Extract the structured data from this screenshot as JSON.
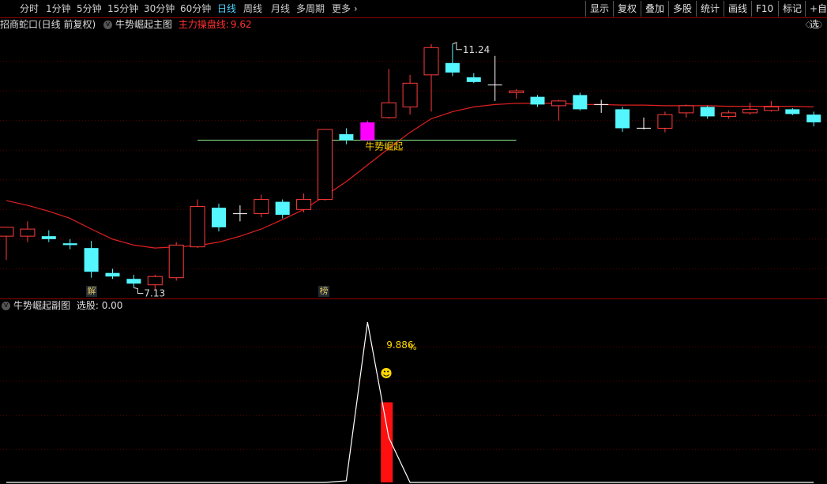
{
  "toolbar": {
    "periods": [
      "分时",
      "1分钟",
      "5分钟",
      "15分钟",
      "30分钟",
      "60分钟",
      "日线",
      "周线",
      "月线",
      "多周期",
      "更多"
    ],
    "active_period": "日线",
    "right_buttons": [
      "显示",
      "复权",
      "叠加",
      "多股",
      "统计",
      "画线",
      "F10",
      "标记",
      "+自选"
    ]
  },
  "main_panel": {
    "stock_title": "招商蛇口(日线 前复权)",
    "indicator_name": "牛势崛起主图",
    "line_label": "主力操盘线:",
    "line_value": "9.62",
    "high_label": "11.24",
    "low_label": "7.13",
    "signal_text": "牛势崛起",
    "marker_left": "解",
    "marker_right": "榜"
  },
  "sub_panel": {
    "indicator_name": "牛势崛起副图",
    "select_label": "选股: 0.00",
    "pct_text": "9.886",
    "pct_suffix": "%",
    "smiley": "☻"
  },
  "colors": {
    "up": "#ff3b3b",
    "down": "#54f6ff",
    "highlight": "#ff00ff",
    "ma_line": "#e02020",
    "signal_line": "#90ee90",
    "grid": "#5a0000"
  },
  "chart_data": {
    "type": "candlestick",
    "candles": [
      {
        "o": 8.0,
        "h": 8.15,
        "l": 7.6,
        "c": 8.15,
        "dir": "up"
      },
      {
        "o": 8.0,
        "h": 8.25,
        "l": 7.9,
        "c": 8.12,
        "dir": "up"
      },
      {
        "o": 8.0,
        "h": 8.1,
        "l": 7.9,
        "c": 7.95,
        "dir": "down"
      },
      {
        "o": 7.88,
        "h": 7.95,
        "l": 7.78,
        "c": 7.85,
        "dir": "down"
      },
      {
        "o": 7.8,
        "h": 7.92,
        "l": 7.3,
        "c": 7.4,
        "dir": "down"
      },
      {
        "o": 7.38,
        "h": 7.45,
        "l": 7.28,
        "c": 7.32,
        "dir": "down"
      },
      {
        "o": 7.28,
        "h": 7.35,
        "l": 7.13,
        "c": 7.2,
        "dir": "down"
      },
      {
        "o": 7.18,
        "h": 7.35,
        "l": 7.1,
        "c": 7.32,
        "dir": "up"
      },
      {
        "o": 7.3,
        "h": 7.9,
        "l": 7.25,
        "c": 7.85,
        "dir": "up"
      },
      {
        "o": 7.82,
        "h": 8.62,
        "l": 7.8,
        "c": 8.5,
        "dir": "up"
      },
      {
        "o": 8.48,
        "h": 8.55,
        "l": 8.08,
        "c": 8.15,
        "dir": "down"
      },
      {
        "o": 8.38,
        "h": 8.52,
        "l": 8.25,
        "c": 8.38,
        "dir": "flat"
      },
      {
        "o": 8.38,
        "h": 8.7,
        "l": 8.32,
        "c": 8.62,
        "dir": "up"
      },
      {
        "o": 8.58,
        "h": 8.62,
        "l": 8.3,
        "c": 8.36,
        "dir": "down"
      },
      {
        "o": 8.45,
        "h": 8.72,
        "l": 8.4,
        "c": 8.62,
        "dir": "up"
      },
      {
        "o": 8.62,
        "h": 9.8,
        "l": 8.6,
        "c": 9.8,
        "dir": "up"
      },
      {
        "o": 9.72,
        "h": 9.82,
        "l": 9.55,
        "c": 9.62,
        "dir": "down"
      },
      {
        "o": 9.62,
        "h": 9.95,
        "l": 9.6,
        "c": 9.92,
        "dir": "highlight"
      },
      {
        "o": 10.0,
        "h": 10.82,
        "l": 9.98,
        "c": 10.25,
        "dir": "up"
      },
      {
        "o": 10.18,
        "h": 10.72,
        "l": 10.05,
        "c": 10.58,
        "dir": "up"
      },
      {
        "o": 10.72,
        "h": 11.24,
        "l": 10.1,
        "c": 11.18,
        "dir": "up"
      },
      {
        "o": 10.92,
        "h": 11.24,
        "l": 10.7,
        "c": 10.76,
        "dir": "down"
      },
      {
        "o": 10.68,
        "h": 10.75,
        "l": 10.58,
        "c": 10.6,
        "dir": "down"
      },
      {
        "o": 10.55,
        "h": 11.04,
        "l": 10.28,
        "c": 10.55,
        "dir": "flat"
      },
      {
        "o": 10.42,
        "h": 10.48,
        "l": 10.32,
        "c": 10.45,
        "dir": "up"
      },
      {
        "o": 10.35,
        "h": 10.38,
        "l": 10.18,
        "c": 10.22,
        "dir": "down"
      },
      {
        "o": 10.2,
        "h": 10.3,
        "l": 9.95,
        "c": 10.28,
        "dir": "up"
      },
      {
        "o": 10.38,
        "h": 10.42,
        "l": 10.12,
        "c": 10.14,
        "dir": "down"
      },
      {
        "o": 10.22,
        "h": 10.3,
        "l": 10.08,
        "c": 10.22,
        "dir": "flat"
      },
      {
        "o": 10.14,
        "h": 10.18,
        "l": 9.76,
        "c": 9.82,
        "dir": "down"
      },
      {
        "o": 9.82,
        "h": 10.0,
        "l": 9.8,
        "c": 9.82,
        "dir": "flat"
      },
      {
        "o": 9.82,
        "h": 10.1,
        "l": 9.75,
        "c": 10.05,
        "dir": "up"
      },
      {
        "o": 10.08,
        "h": 10.22,
        "l": 10.0,
        "c": 10.2,
        "dir": "up"
      },
      {
        "o": 10.18,
        "h": 10.2,
        "l": 9.98,
        "c": 10.02,
        "dir": "down"
      },
      {
        "o": 10.02,
        "h": 10.12,
        "l": 9.98,
        "c": 10.08,
        "dir": "up"
      },
      {
        "o": 10.08,
        "h": 10.25,
        "l": 10.05,
        "c": 10.14,
        "dir": "up"
      },
      {
        "o": 10.12,
        "h": 10.28,
        "l": 10.1,
        "c": 10.18,
        "dir": "up"
      },
      {
        "o": 10.14,
        "h": 10.16,
        "l": 10.04,
        "c": 10.06,
        "dir": "down"
      },
      {
        "o": 10.05,
        "h": 10.1,
        "l": 9.85,
        "c": 9.92,
        "dir": "down"
      }
    ],
    "ma_line": [
      8.6,
      8.52,
      8.42,
      8.3,
      8.12,
      7.95,
      7.85,
      7.8,
      7.82,
      7.84,
      7.9,
      8.0,
      8.12,
      8.28,
      8.45,
      8.68,
      8.92,
      9.2,
      9.48,
      9.75,
      9.98,
      10.1,
      10.18,
      10.22,
      10.24,
      10.24,
      10.24,
      10.22,
      10.22,
      10.21,
      10.21,
      10.2,
      10.2,
      10.2,
      10.19,
      10.19,
      10.19,
      10.19,
      10.18
    ],
    "signal_level": 9.62,
    "signal_range": [
      9,
      24
    ],
    "sub_line": [
      0,
      0,
      0,
      0,
      0,
      0,
      0,
      0,
      0,
      0,
      0,
      0,
      0,
      0,
      0,
      0,
      1,
      100,
      28,
      0,
      0,
      0,
      0,
      0,
      0,
      0,
      0,
      0,
      0,
      0,
      0,
      0,
      0,
      0,
      0,
      0,
      0,
      0,
      0
    ],
    "sub_bar": {
      "index": 17,
      "value": 50
    }
  }
}
